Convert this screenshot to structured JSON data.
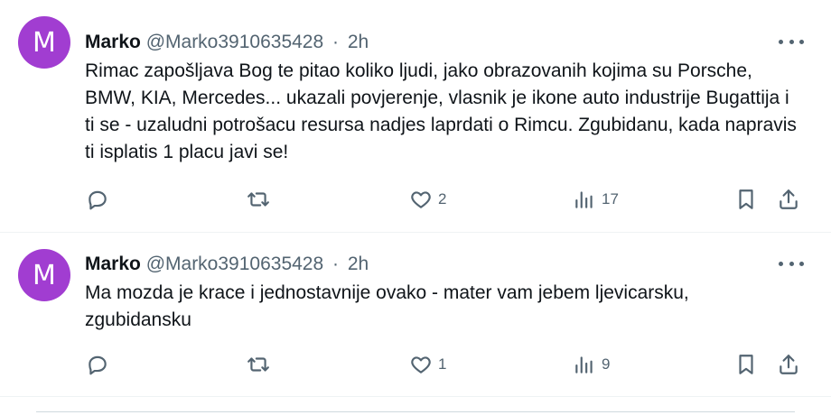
{
  "tweets": [
    {
      "avatar_letter": "M",
      "name": "Marko",
      "handle": "@Marko3910635428",
      "separator": "·",
      "time": "2h",
      "text": "Rimac zapošljava Bog te pitao koliko ljudi, jako obrazovanih kojima su Porsche, BMW, KIA, Mercedes... ukazali povjerenje, vlasnik je ikone auto industrije Bugattija i ti se - uzaludni potrošacu resursa nadjes laprdati o Rimcu. Zgubidanu, kada napravis ti isplatis 1 placu javi se!",
      "likes": "2",
      "views": "17"
    },
    {
      "avatar_letter": "M",
      "name": "Marko",
      "handle": "@Marko3910635428",
      "separator": "·",
      "time": "2h",
      "text": "Ma mozda je krace i jednostavnije ovako - mater vam jebem ljevicarsku, zgubidansku",
      "likes": "1",
      "views": "9"
    }
  ],
  "icons": [
    "reply-icon",
    "retweet-icon",
    "like-icon",
    "views-icon",
    "bookmark-icon",
    "share-icon",
    "more-icon"
  ],
  "colors": {
    "avatar": "#a13dd1",
    "secondary_text": "#536471",
    "primary_text": "#0f1419",
    "divider": "#eff3f4"
  }
}
